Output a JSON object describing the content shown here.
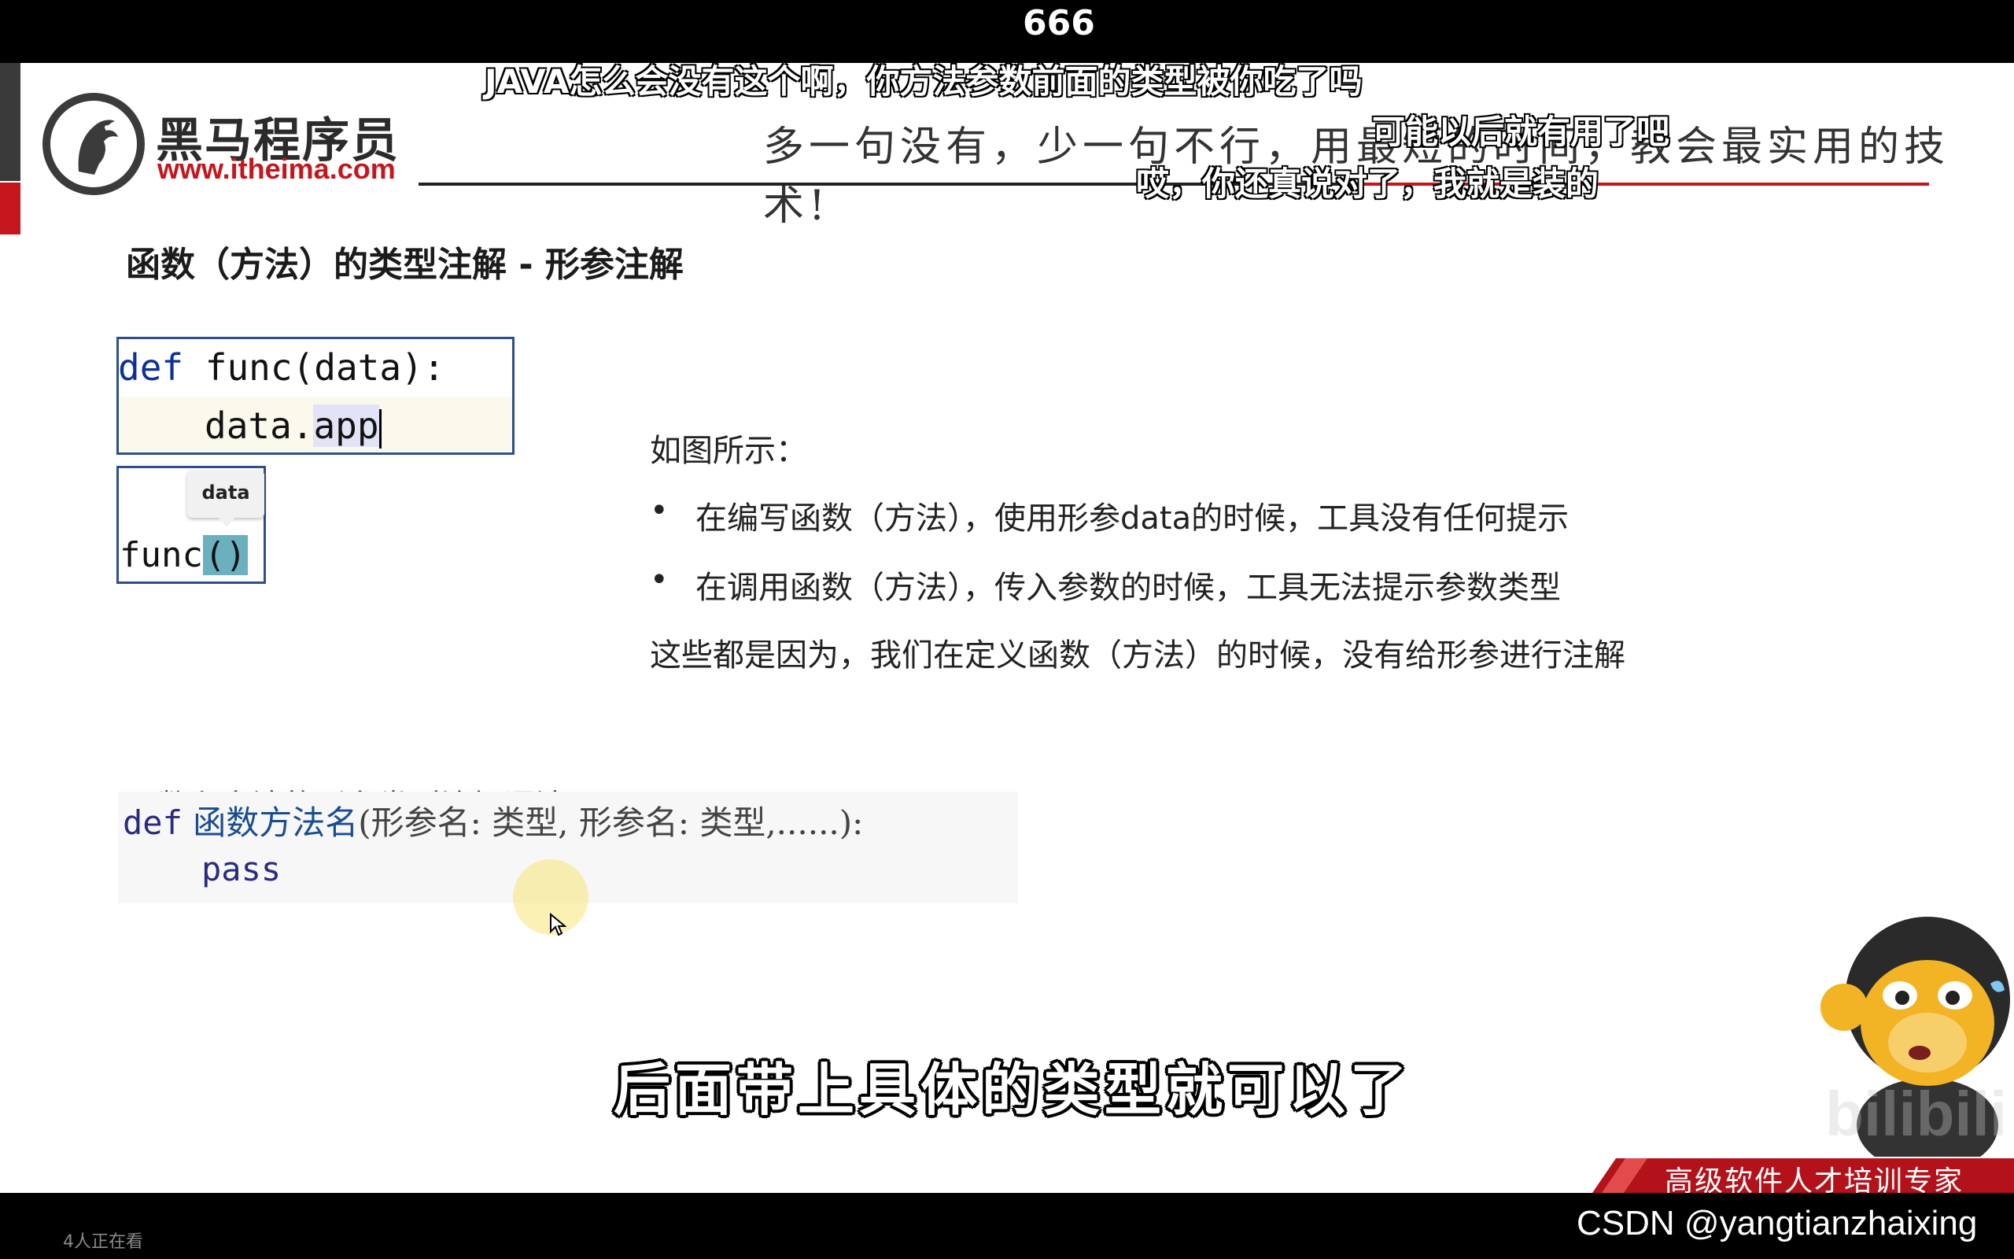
{
  "top_danmaku": "666",
  "danmaku": [
    "JAVA怎么会没有这个啊，你方法参数前面的类型被你吃了吗",
    "可能以后就有用了吧",
    "哎，你还真说对了，我就是装的"
  ],
  "logo": {
    "name_cn": "黑马程序员",
    "url": "www.itheima.com"
  },
  "slogan": "多一句没有，少一句不行，用最短的时间，教会最实用的技术!",
  "slide": {
    "title": "函数（方法）的类型注解 - 形参注解",
    "code_example_1": {
      "line1_kw": "def",
      "line1_rest": " func(data):",
      "line2_prefix": "data.",
      "line2_typed": "app"
    },
    "code_example_2": {
      "tooltip": "data",
      "call_name": "func",
      "call_parens": "()"
    },
    "description": {
      "heading": "如图所示：",
      "bullet_symbol": "•",
      "bullets": [
        "在编写函数（方法），使用形参data的时候，工具没有任何提示",
        "在调用函数（方法），传入参数的时候，工具无法提示参数类型"
      ],
      "conclusion": "这些都是因为，我们在定义函数（方法）的时候，没有给形参进行注解"
    },
    "syntax_title": "函数和方法的形参类型注解语法：",
    "syntax_code": {
      "kw": "def",
      "func_name": "函数方法名",
      "params": "(形参名: 类型, 形参名: 类型,......):",
      "body": "pass"
    }
  },
  "subtitle": "后面带上具体的类型就可以了",
  "watermark": "bilibili",
  "banner": "高级软件人才培训专家",
  "footer": {
    "viewers": "4人正在看",
    "csdn": "CSDN @yangtianzhaixing"
  }
}
